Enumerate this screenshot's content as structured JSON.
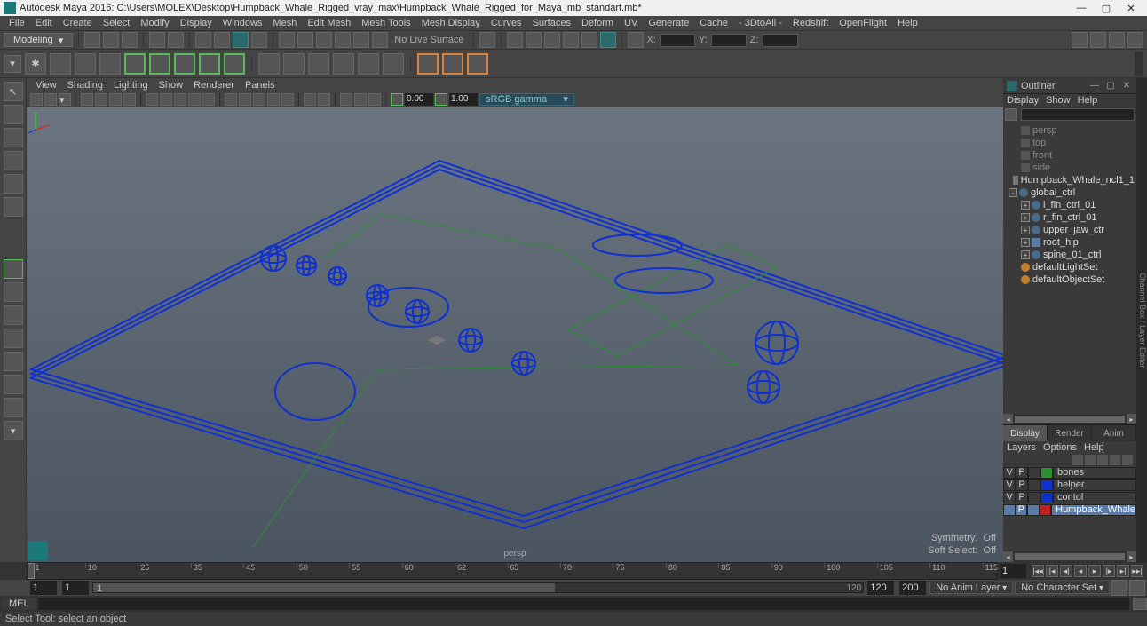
{
  "app": {
    "title": "Autodesk Maya 2016: C:\\Users\\MOLEX\\Desktop\\Humpback_Whale_Rigged_vray_max\\Humpback_Whale_Rigged_for_Maya_mb_standart.mb*"
  },
  "mainMenu": [
    "File",
    "Edit",
    "Create",
    "Select",
    "Modify",
    "Display",
    "Windows",
    "Mesh",
    "Edit Mesh",
    "Mesh Tools",
    "Mesh Display",
    "Curves",
    "Surfaces",
    "Deform",
    "UV",
    "Generate",
    "Cache",
    "- 3DtoAll -",
    "Redshift",
    "OpenFlight",
    "Help"
  ],
  "modeSelector": "Modeling",
  "shelf": {
    "noLive": "No Live Surface",
    "x": "X:",
    "y": "Y:",
    "z": "Z:"
  },
  "vpMenu": [
    "View",
    "Shading",
    "Lighting",
    "Show",
    "Renderer",
    "Panels"
  ],
  "vpToolbar": {
    "val1": "0.00",
    "val2": "1.00",
    "gamma": "sRGB gamma"
  },
  "viewport": {
    "name": "persp",
    "hud": {
      "sym": "Symmetry:",
      "symVal": "Off",
      "soft": "Soft Select:",
      "softVal": "Off"
    }
  },
  "outliner": {
    "title": "Outliner",
    "menu": [
      "Display",
      "Show",
      "Help"
    ],
    "items": [
      {
        "indent": 1,
        "icon": "cam",
        "label": "persp",
        "dim": true
      },
      {
        "indent": 1,
        "icon": "cam",
        "label": "top",
        "dim": true
      },
      {
        "indent": 1,
        "icon": "cam",
        "label": "front",
        "dim": true
      },
      {
        "indent": 1,
        "icon": "cam",
        "label": "side",
        "dim": true
      },
      {
        "indent": 1,
        "icon": "grp",
        "label": "Humpback_Whale_ncl1_1",
        "dim": false
      },
      {
        "indent": 0,
        "icon": "ctrl",
        "label": "global_ctrl",
        "dim": false,
        "exp": "-"
      },
      {
        "indent": 1,
        "icon": "ctrl",
        "label": "l_fin_ctrl_01",
        "dim": false,
        "exp": "+"
      },
      {
        "indent": 1,
        "icon": "ctrl",
        "label": "r_fin_ctrl_01",
        "dim": false,
        "exp": "+"
      },
      {
        "indent": 1,
        "icon": "ctrl",
        "label": "upper_jaw_ctr",
        "dim": false,
        "exp": "+"
      },
      {
        "indent": 1,
        "icon": "jnt",
        "label": "root_hip",
        "dim": false,
        "exp": "+"
      },
      {
        "indent": 1,
        "icon": "ctrl",
        "label": "spine_01_ctrl",
        "dim": false,
        "exp": "+"
      },
      {
        "indent": 1,
        "icon": "set",
        "label": "defaultLightSet",
        "dim": false
      },
      {
        "indent": 1,
        "icon": "set",
        "label": "defaultObjectSet",
        "dim": false
      }
    ]
  },
  "layerBox": {
    "tabs": [
      "Display",
      "Render",
      "Anim"
    ],
    "menu": [
      "Layers",
      "Options",
      "Help"
    ],
    "layers": [
      {
        "v": "V",
        "p": "P",
        "color": "#2a9030",
        "name": "bones",
        "sel": false
      },
      {
        "v": "V",
        "p": "P",
        "color": "#1030d0",
        "name": "helper",
        "sel": false
      },
      {
        "v": "V",
        "p": "P",
        "color": "#1030d0",
        "name": "contol",
        "sel": false
      },
      {
        "v": "",
        "p": "P",
        "color": "#c02020",
        "name": "Humpback_Whale",
        "sel": true
      }
    ]
  },
  "time": {
    "ticks": [
      "1",
      "10",
      "25",
      "35",
      "45",
      "50",
      "55",
      "60",
      "62",
      "65",
      "70",
      "75",
      "80",
      "85",
      "90",
      "100",
      "105",
      "110",
      "115"
    ],
    "cur": "1",
    "rangeStart1": "1",
    "rangeStart2": "1",
    "rangeMid": "1",
    "rangeBarEnd": "120",
    "rangeEnd1": "120",
    "rangeEnd2": "200",
    "animLayer": "No Anim Layer",
    "charSet": "No Character Set"
  },
  "mel": {
    "label": "MEL"
  },
  "status": "Select Tool: select an object"
}
